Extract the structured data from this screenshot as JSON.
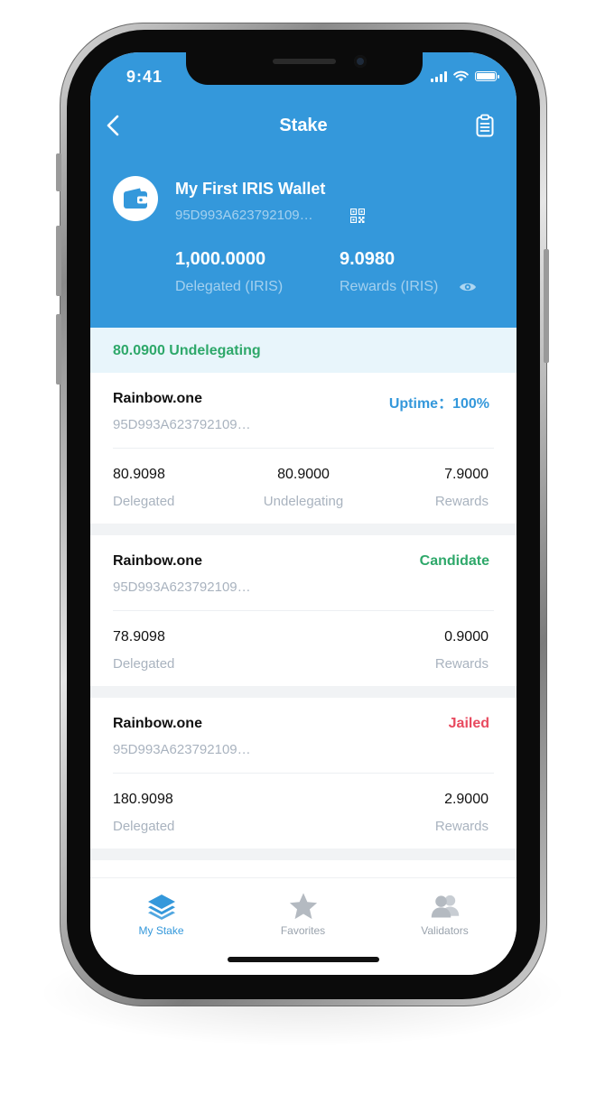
{
  "status_bar": {
    "time": "9:41"
  },
  "nav": {
    "title": "Stake"
  },
  "wallet": {
    "name": "My First IRIS Wallet",
    "address": "95D993A623792109…",
    "delegated_value": "1,000.0000",
    "delegated_label": "Delegated (IRIS)",
    "rewards_value": "9.0980",
    "rewards_label": "Rewards (IRIS)"
  },
  "undelegating_banner": "80.0900 Undelegating",
  "validators": [
    {
      "name": "Rainbow.one",
      "status": "Uptime：100%",
      "address": "95D993A623792109…",
      "delegated": "80.9098",
      "delegated_label": "Delegated",
      "undelegating": "80.9000",
      "undelegating_label": "Undelegating",
      "rewards": "7.9000",
      "rewards_label": "Rewards"
    },
    {
      "name": "Rainbow.one",
      "status": "Candidate",
      "address": "95D993A623792109…",
      "delegated": "78.9098",
      "delegated_label": "Delegated",
      "rewards": "0.9000",
      "rewards_label": "Rewards"
    },
    {
      "name": "Rainbow.one",
      "status": "Jailed",
      "address": "95D993A623792109…",
      "delegated": "180.9098",
      "delegated_label": "Delegated",
      "rewards": "2.9000",
      "rewards_label": "Rewards"
    }
  ],
  "status_colors": {
    "uptime": "#3498db",
    "candidate": "#2ea86a",
    "jailed": "#e84a5f"
  },
  "tabs": [
    {
      "label": "My Stake",
      "icon": "layers-icon",
      "active": true
    },
    {
      "label": "Favorites",
      "icon": "star-icon",
      "active": false
    },
    {
      "label": "Validators",
      "icon": "users-icon",
      "active": false
    }
  ],
  "colors": {
    "primary": "#3498db",
    "tab_active": "#3498db",
    "tab_inactive": "#9aa3ad"
  }
}
